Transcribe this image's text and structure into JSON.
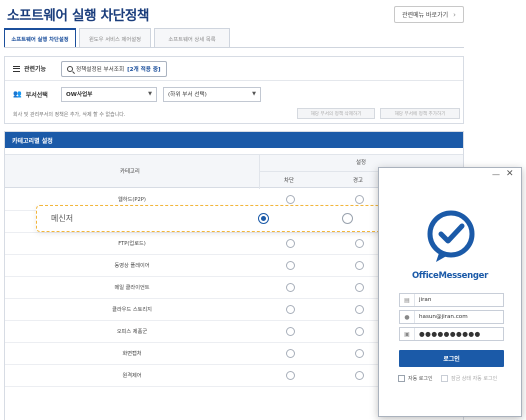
{
  "page": {
    "title": "소프트웨어 실행 차단정책",
    "goto_label": "관련메뉴 바로가기"
  },
  "tabs": [
    {
      "label": "소프트웨어 실행 차단설정"
    },
    {
      "label": "윈도우 서비스 제어설정"
    },
    {
      "label": "소프트웨어 상세 목록"
    }
  ],
  "filters": {
    "function_label": "관련기능",
    "search_btn_label": "정책설정된 부서조회",
    "search_btn_count": "[2개 적용 중]",
    "dept_label": "부서선택",
    "dept_value": "OW사업부",
    "subdept_value": "(하위 부서 선택)",
    "notice": "회사 및 관리부서의 정책은 추가, 삭제 할 수 없습니다.",
    "delete_btn": "해당 부서의 정책 삭제하기",
    "add_btn": "해당 부서에 정책 추가하기"
  },
  "category": {
    "header": "카테고리별 설정",
    "col_category": "카테고리",
    "col_setting": "설정",
    "col_block": "차단",
    "col_warn": "경고",
    "rows": [
      "웹하드(P2P)",
      "메신저",
      "FTP(업로드)",
      "동영상 플레이어",
      "메일 클라이언트",
      "클라우드 스토리지",
      "오피스 제품군",
      "화면캡처",
      "원격제어"
    ]
  },
  "highlight": {
    "label": "메신저",
    "selected": "block"
  },
  "messenger": {
    "app_name": "OfficeMessenger",
    "id_value": "jiran",
    "email_value": "hasun@jiran.com",
    "password_mask": "●●●●●●●●●●",
    "login_label": "로그인",
    "auto_login": "자동 로그인",
    "lock_login": "잠금 상태 자동 로그인",
    "accent_color": "#1b5aa8"
  }
}
